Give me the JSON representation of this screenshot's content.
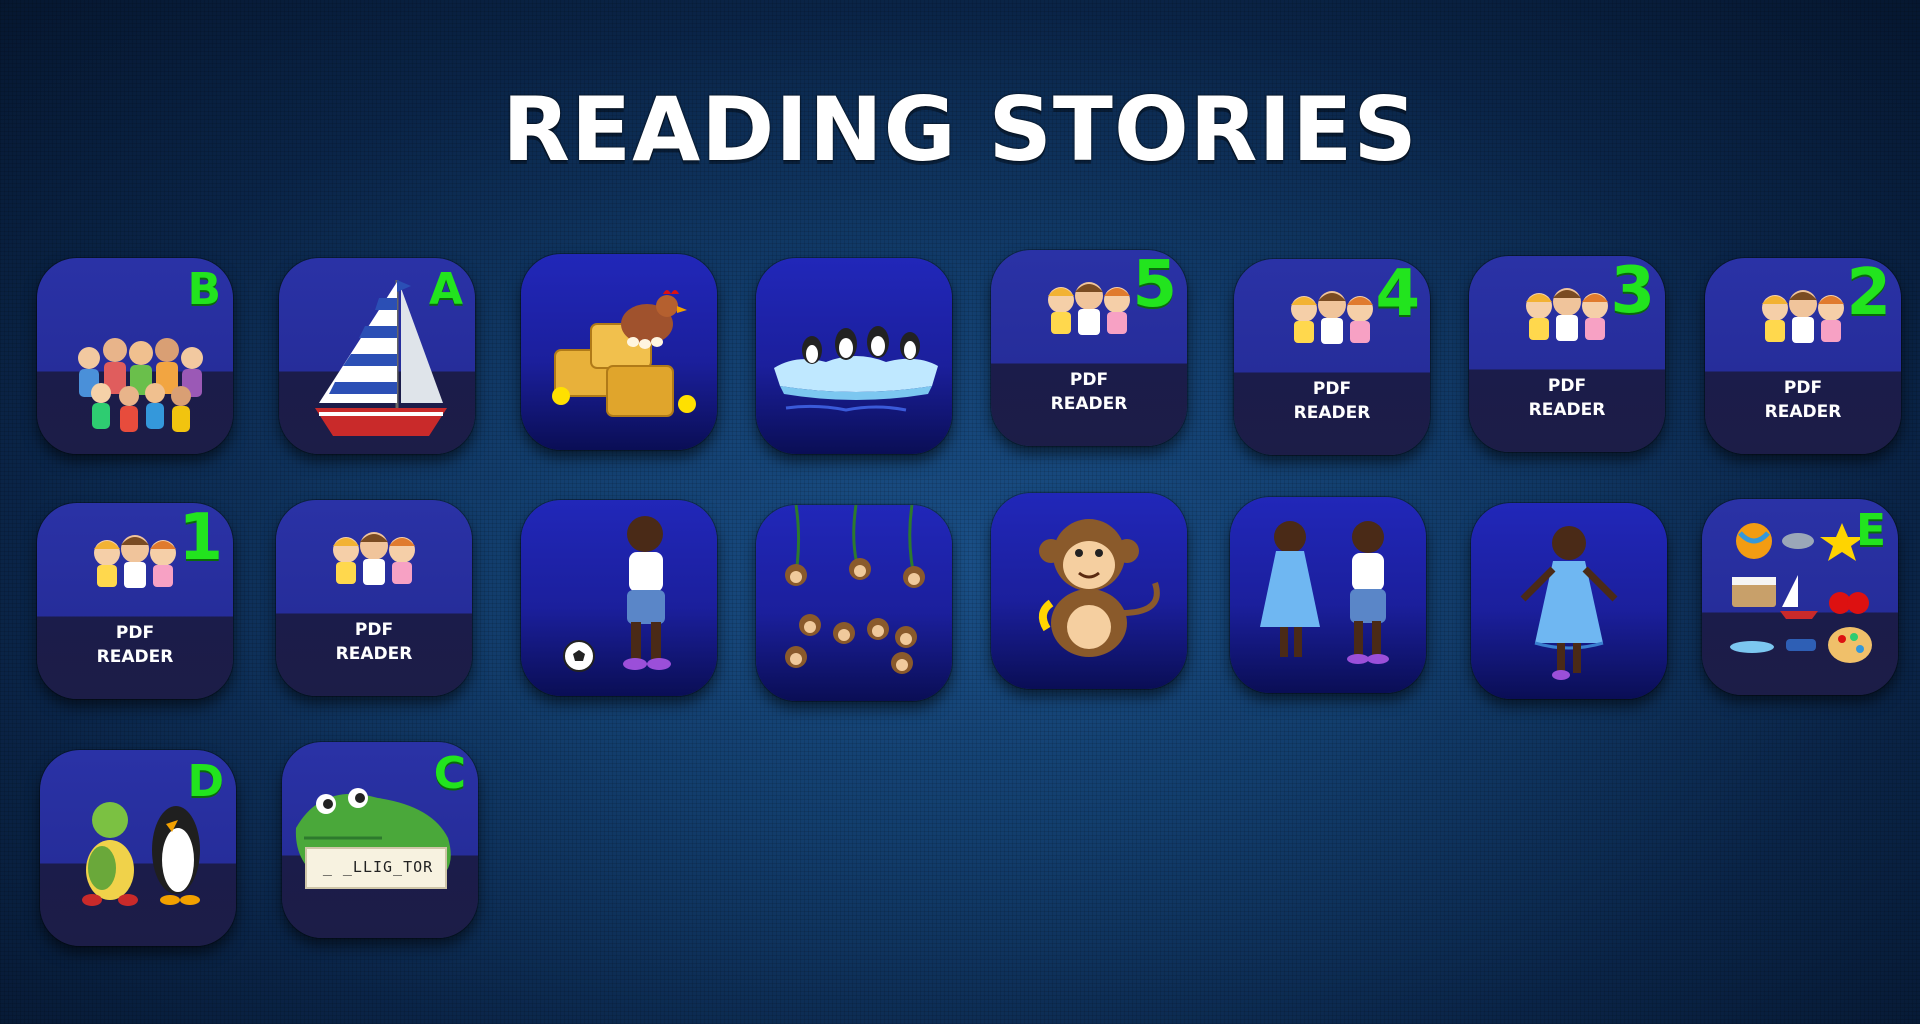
{
  "page": {
    "title": "READING STORIES"
  },
  "colors": {
    "letter": "#22e41e",
    "tile_top": "#2a32a6",
    "tile_bottom": "#1b1c4a"
  },
  "tiles": [
    {
      "id": "family",
      "letter": "B",
      "icon": "family-group-icon"
    },
    {
      "id": "sailboat",
      "letter": "A",
      "icon": "sailboat-icon"
    },
    {
      "id": "hen",
      "icon": "hen-hay-icon"
    },
    {
      "id": "penguins",
      "icon": "penguins-iceberg-icon"
    },
    {
      "id": "pdf5",
      "letter": "5",
      "line1": "PDF",
      "line2": "READER",
      "icon": "kids-icon"
    },
    {
      "id": "pdf4",
      "letter": "4",
      "line1": "PDF",
      "line2": "READER",
      "icon": "kids-icon"
    },
    {
      "id": "pdf3",
      "letter": "3",
      "line1": "PDF",
      "line2": "READER",
      "icon": "kids-icon"
    },
    {
      "id": "pdf2",
      "letter": "2",
      "line1": "PDF",
      "line2": "READER",
      "icon": "kids-icon"
    },
    {
      "id": "pdf1",
      "letter": "1",
      "line1": "PDF",
      "line2": "READER",
      "icon": "kids-icon"
    },
    {
      "id": "pdf0",
      "line1": "PDF",
      "line2": "READER",
      "icon": "kids-icon"
    },
    {
      "id": "boy",
      "icon": "boy-soccer-icon"
    },
    {
      "id": "monkeys",
      "icon": "monkeys-vines-icon"
    },
    {
      "id": "monkey",
      "icon": "monkey-banana-icon"
    },
    {
      "id": "girlboy",
      "icon": "girl-and-boy-icon"
    },
    {
      "id": "girl",
      "icon": "girl-dress-icon"
    },
    {
      "id": "objects",
      "letter": "E",
      "icon": "objects-grid-icon"
    },
    {
      "id": "turtle",
      "letter": "D",
      "icon": "turtle-penguin-icon"
    },
    {
      "id": "alligator",
      "letter": "C",
      "caption": "_ _LLIG_TOR",
      "icon": "alligator-icon"
    }
  ]
}
